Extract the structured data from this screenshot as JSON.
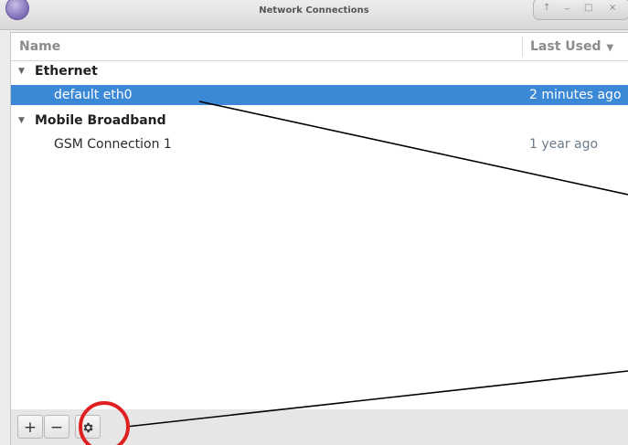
{
  "window": {
    "title": "Network Connections",
    "buttons": {
      "up": "↑",
      "minimize": "_",
      "maximize": "□",
      "close": "×"
    }
  },
  "table": {
    "columns": {
      "name": "Name",
      "last_used": "Last Used"
    },
    "sort_icon": "chevron-down-icon"
  },
  "groups": [
    {
      "label": "Ethernet",
      "items": [
        {
          "name": "default eth0",
          "last_used": "2 minutes ago",
          "selected": true
        }
      ]
    },
    {
      "label": "Mobile Broadband",
      "items": [
        {
          "name": "GSM Connection 1",
          "last_used": "1 year ago",
          "selected": false
        }
      ]
    }
  ],
  "toolbar": {
    "add_label": "+",
    "remove_label": "−",
    "settings_icon": "gear-icon"
  },
  "colors": {
    "selection": "#3b88d6",
    "annotation_circle": "#e02020",
    "annotation_line": "#000000"
  }
}
